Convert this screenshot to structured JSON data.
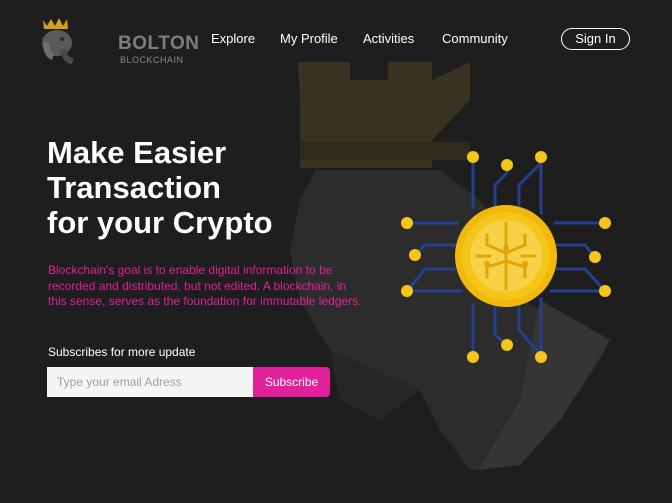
{
  "header": {
    "logo": {
      "name": "BOLTON",
      "subtitle": "BLOCKCHAIN"
    },
    "nav": [
      {
        "label": "Explore"
      },
      {
        "label": "My Profile"
      },
      {
        "label": "Activities"
      },
      {
        "label": "Community"
      }
    ],
    "signin_label": "Sign In"
  },
  "hero": {
    "title_lines": [
      "Make Easier",
      "Transaction",
      "for your Crypto"
    ],
    "description": "Blockchain's goal is to enable digital information to be recorded and distributed, but not edited. A blockchain, in this sense, serves as the foundation for immutable ledgers."
  },
  "subscribe": {
    "label": "Subscribes for more update",
    "placeholder": "Type your email Adress",
    "button_label": "Subscribe"
  },
  "colors": {
    "background": "#1e1e1e",
    "accent_pink": "#e0219a",
    "coin_gold": "#f5c518",
    "circuit_blue": "#1f3a8a"
  },
  "icons": [
    "chess-rook-icon",
    "elephant-logo-icon",
    "crown-icon",
    "crypto-coin-icon"
  ]
}
